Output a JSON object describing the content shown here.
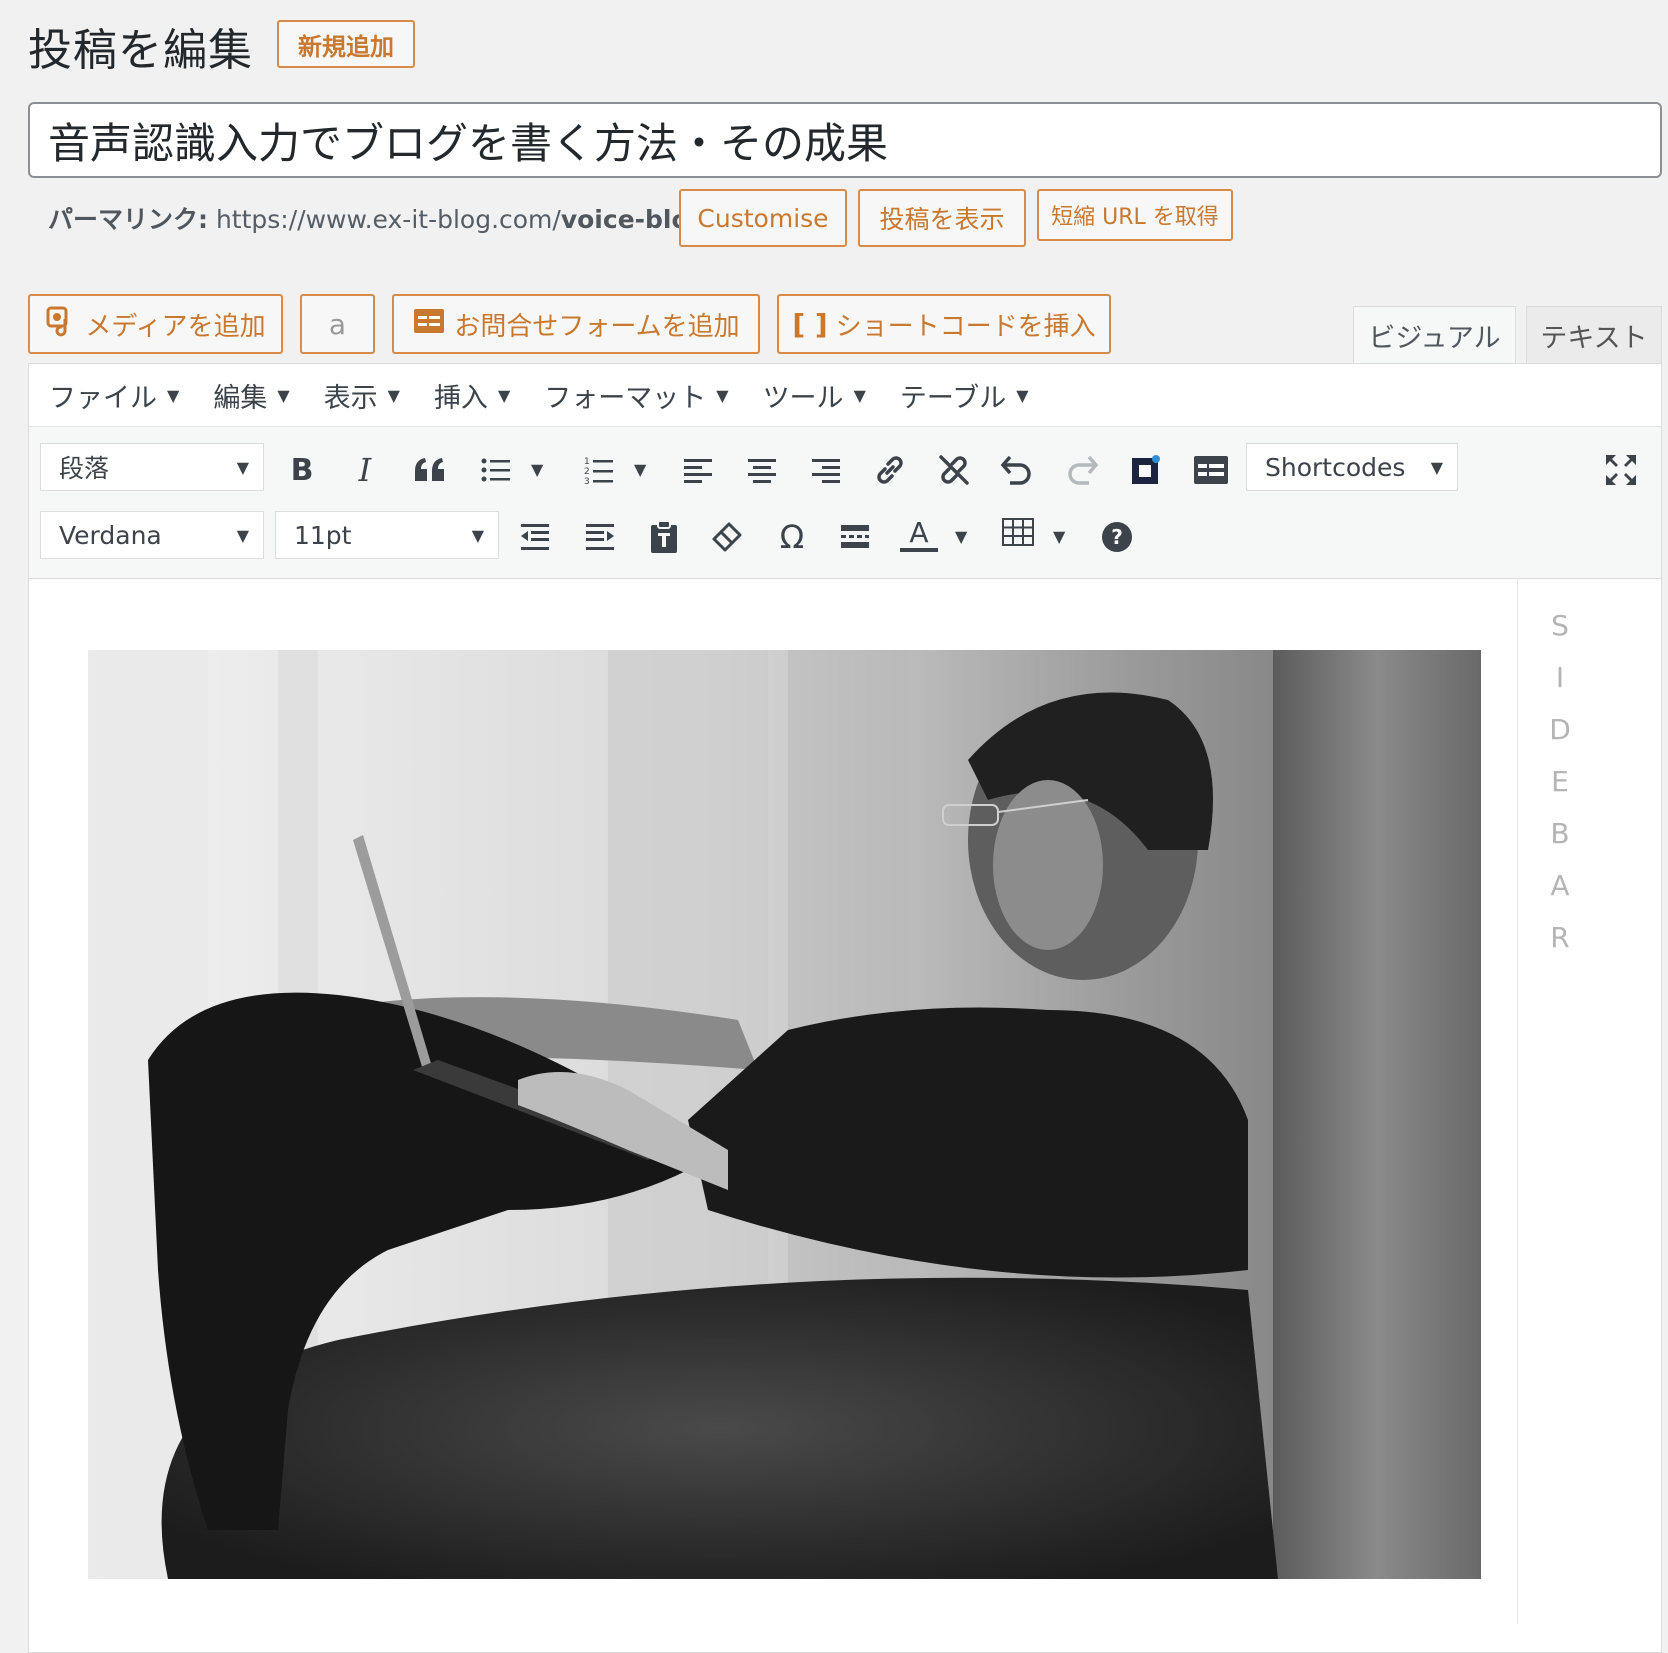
{
  "header": {
    "title": "投稿を編集",
    "add_new": "新規追加"
  },
  "post": {
    "title": "音声認識入力でブログを書く方法・その成果"
  },
  "permalink": {
    "label": "パーマリンク:",
    "url_base": "https://www.ex-it-blog.com/",
    "slug": "voice-blog",
    "buttons": {
      "customise": "Customise",
      "view": "投稿を表示",
      "shortlink": "短縮 URL を取得"
    }
  },
  "media_bar": {
    "add_media": "メディアを追加",
    "amazon": "a",
    "contact_form": "お問合せフォームを追加",
    "shortcode": "ショートコードを挿入"
  },
  "editor_tabs": {
    "visual": "ビジュアル",
    "text": "テキスト"
  },
  "menubar": [
    "ファイル",
    "編集",
    "表示",
    "挿入",
    "フォーマット",
    "ツール",
    "テーブル"
  ],
  "toolbar": {
    "format_select": "段落",
    "shortcodes_select": "Shortcodes",
    "font_family": "Verdana",
    "font_size": "11pt",
    "bold": "B",
    "italic": "I",
    "omega": "Ω",
    "text_color": "A",
    "help": "?"
  },
  "sidebar_placeholder": [
    "S",
    "I",
    "D",
    "E",
    "B",
    "A",
    "R"
  ],
  "colors": {
    "accent": "#c9782f",
    "background": "#f1f1f1"
  }
}
